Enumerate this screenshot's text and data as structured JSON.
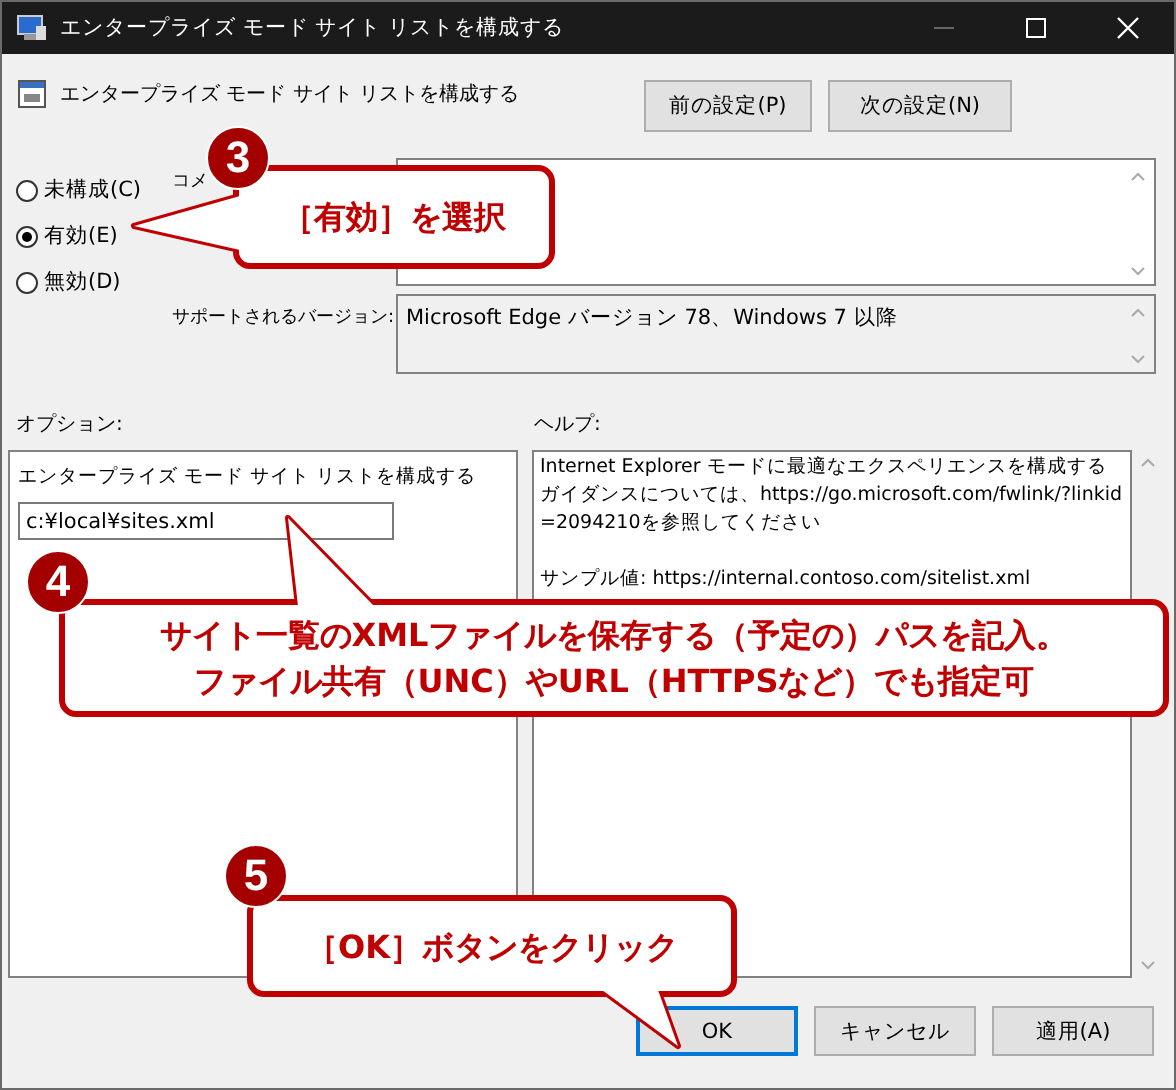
{
  "window": {
    "title": "エンタープライズ モード サイト リストを構成する"
  },
  "policy_title": "エンタープライズ モード サイト リストを構成する",
  "nav_buttons": [
    "前の設定(P)",
    "次の設定(N)"
  ],
  "radios": [
    {
      "label": "未構成(C)",
      "selected": false
    },
    {
      "label": "有効(E)",
      "selected": true
    },
    {
      "label": "無効(D)",
      "selected": false
    }
  ],
  "comment": {
    "label": "コメ"
  },
  "supported": {
    "label": "サポートされるバージョン:",
    "value": "Microsoft Edge バージョン 78、Windows 7 以降"
  },
  "options": {
    "label": "オプション:",
    "field_label": "エンタープライズ モード サイト リストを構成する",
    "value": "c:¥local¥sites.xml"
  },
  "help": {
    "label": "ヘルプ:",
    "paragraphs": [
      "Internet Explorer モードに最適なエクスペリエンスを構成するガイダンスについては、https://go.microsoft.com/fwlink/?linkid=2094210を参照してください",
      "サンプル値: https://internal.contoso.com/sitelist.xml"
    ]
  },
  "buttons": [
    {
      "label": "OK",
      "focused": true
    },
    {
      "label": "キャンセル",
      "focused": false
    },
    {
      "label": "適用(A)",
      "focused": false
    }
  ],
  "callouts": [
    {
      "number": "3",
      "lines": [
        "［有効］を選択"
      ]
    },
    {
      "number": "4",
      "lines": [
        "サイト一覧のXMLファイルを保存する（予定の）パスを記入。",
        "ファイル共有（UNC）やURL（HTTPSなど）でも指定可"
      ]
    },
    {
      "number": "5",
      "lines": [
        "［OK］ボタンをクリック"
      ]
    }
  ]
}
